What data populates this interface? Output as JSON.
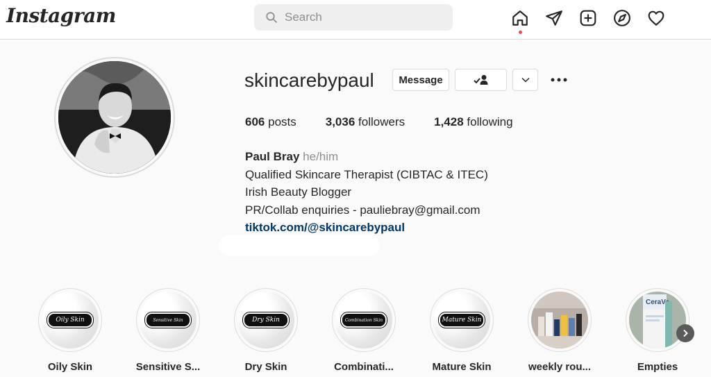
{
  "header": {
    "logo": "Instagram",
    "search_placeholder": "Search",
    "nav_icons": [
      "home-icon",
      "direct-icon",
      "new-post-icon",
      "explore-icon",
      "activity-icon"
    ]
  },
  "profile": {
    "username": "skincarebypaul",
    "message_label": "Message",
    "stats": {
      "posts_count": "606",
      "posts_label": "posts",
      "followers_count": "3,036",
      "followers_label": "followers",
      "following_count": "1,428",
      "following_label": "following"
    },
    "bio": {
      "name": "Paul Bray",
      "pronouns": "he/him",
      "line1": "Qualified Skincare Therapist (CIBTAC & ITEC)",
      "line2": "Irish Beauty Blogger",
      "line3": "PR/Collab enquiries - pauliebray@gmail.com",
      "link": "tiktok.com/@skincarebypaul"
    }
  },
  "highlights": [
    {
      "label": "Oily Skin",
      "cover_text": "Oily Skin"
    },
    {
      "label": "Sensitive S...",
      "cover_text": "Sensitive Skin"
    },
    {
      "label": "Dry Skin",
      "cover_text": "Dry Skin"
    },
    {
      "label": "Combinati...",
      "cover_text": "Combination Skin"
    },
    {
      "label": "Mature Skin",
      "cover_text": "Mature Skin"
    },
    {
      "label": "weekly rou...",
      "cover_text": ""
    },
    {
      "label": "Empties",
      "cover_text": "CeraVe"
    }
  ],
  "colors": {
    "link": "#00376b",
    "notification": "#ed4956",
    "border": "#dbdbdb"
  }
}
